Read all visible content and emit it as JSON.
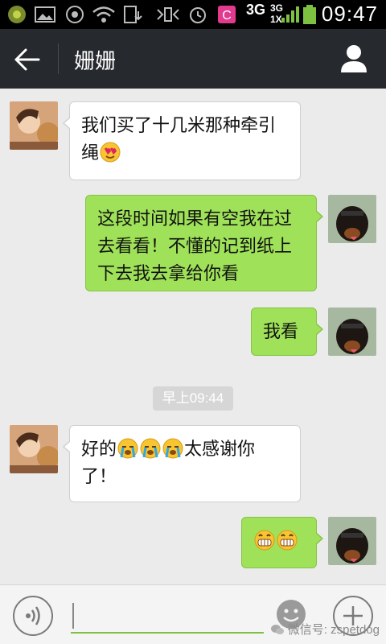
{
  "status_bar": {
    "network_a": "3G",
    "network_b": "3G",
    "network_b_sub": "1X",
    "time": "09:47",
    "icons": [
      "app-icon",
      "gallery-icon",
      "phone-icon",
      "wifi-icon",
      "download-icon",
      "vibrate-icon",
      "alarm-icon",
      "c-app-icon",
      "signal-icon",
      "battery-icon"
    ]
  },
  "header": {
    "title": "姗姗",
    "back_icon": "back-arrow-icon",
    "profile_icon": "person-icon"
  },
  "messages": [
    {
      "side": "left",
      "sender": "姗姗",
      "text": "我们买了十几米那种牵引绳",
      "emoji": [
        "heart-eyes"
      ]
    },
    {
      "side": "right",
      "sender": "me",
      "text": "这段时间如果有空我在过去看看！不懂的记到纸上下去我去拿给你看"
    },
    {
      "side": "right",
      "sender": "me",
      "text": "我看"
    },
    {
      "side": "left",
      "sender": "姗姗",
      "text_before": "好的",
      "emoji": [
        "crying",
        "crying",
        "crying"
      ],
      "text_after": "太感谢你了！"
    },
    {
      "side": "right",
      "sender": "me",
      "emoji": [
        "grinning",
        "grinning"
      ]
    }
  ],
  "timestamp": "早上09:44",
  "input_bar": {
    "voice_icon": "voice-icon",
    "input_value": "",
    "emoji_icon": "emoji-icon",
    "plus_icon": "plus-icon"
  },
  "watermark": "微信号: zspetdog",
  "colors": {
    "titlebar": "#26292e",
    "chat_bg": "#ebebeb",
    "bubble_sent": "#9fe259",
    "bubble_received": "#ffffff",
    "input_underline": "#7ec141"
  }
}
